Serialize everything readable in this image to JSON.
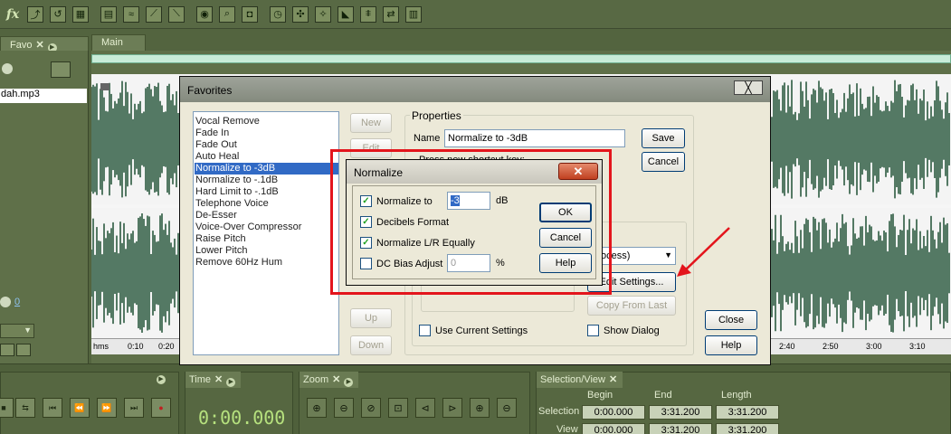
{
  "toolbar": {
    "icons": [
      "fx-icon",
      "envelope-icon",
      "loop-icon",
      "grid-icon",
      "edit-view-icon",
      "spectral-icon",
      "pitch-icon",
      "phase-icon",
      "zoom-icon",
      "find-icon",
      "capture-icon",
      "metronome-icon",
      "snap-icon",
      "marker-icon",
      "slope-icon",
      "multitrack-icon",
      "cd-icon"
    ],
    "fx_label": "fx"
  },
  "favorites_panel": {
    "tab": "Favo",
    "file": "dah.mp3",
    "volume_value": "0"
  },
  "main_panel": {
    "tab": "Main"
  },
  "ruler": {
    "labels": [
      "hms",
      "0:10",
      "0:20",
      "2:40",
      "2:50",
      "3:00",
      "3:10"
    ]
  },
  "time_panel": {
    "tab": "Time",
    "value": "0:00.000"
  },
  "zoom_panel": {
    "tab": "Zoom"
  },
  "selection_panel": {
    "tab": "Selection/View",
    "headers": [
      "Begin",
      "End",
      "Length"
    ],
    "rows": [
      {
        "label": "Selection",
        "begin": "0:00.000",
        "end": "3:31.200",
        "length": "3:31.200"
      },
      {
        "label": "View",
        "begin": "0:00.000",
        "end": "3:31.200",
        "length": "3:31.200"
      }
    ]
  },
  "favorites_dialog": {
    "title": "Favorites",
    "close": "╳",
    "items": [
      "Vocal Remove",
      "Fade In",
      "Fade Out",
      "Auto Heal",
      "Normalize to -3dB",
      "Normalize to -.1dB",
      "Hard Limit to -.1dB",
      "Telephone Voice",
      "De-Esser",
      "Voice-Over Compressor",
      "Raise Pitch",
      "Lower Pitch",
      "Remove 60Hz Hum"
    ],
    "selected_index": 4,
    "buttons": {
      "new": "New",
      "edit": "Edit",
      "up": "Up",
      "down": "Down",
      "save": "Save",
      "cancel": "Cancel",
      "close": "Close",
      "help": "Help"
    },
    "properties_label": "Properties",
    "name_label": "Name",
    "name_value": "Normalize to -3dB",
    "shortcut_prompt": "Press new shortcut key:",
    "dropdown_value": "ocess)",
    "edit_settings": "Edit Settings...",
    "copy_from_last": "Copy From Last",
    "use_current_settings": "Use Current Settings",
    "show_dialog": "Show Dialog"
  },
  "normalize_dialog": {
    "title": "Normalize",
    "close": "✕",
    "normalize_to_label": "Normalize to",
    "normalize_to_value": "-3",
    "normalize_to_unit": "dB",
    "decibels_format": "Decibels Format",
    "normalize_lr": "Normalize L/R Equally",
    "dc_bias_label": "DC Bias Adjust",
    "dc_bias_value": "0",
    "dc_bias_unit": "%",
    "ok": "OK",
    "cancel": "Cancel",
    "help": "Help"
  },
  "colors": {
    "highlight": "#e3151c",
    "selection": "#316ac5",
    "panel": "#53643f",
    "time_digits": "#b6e17e"
  }
}
